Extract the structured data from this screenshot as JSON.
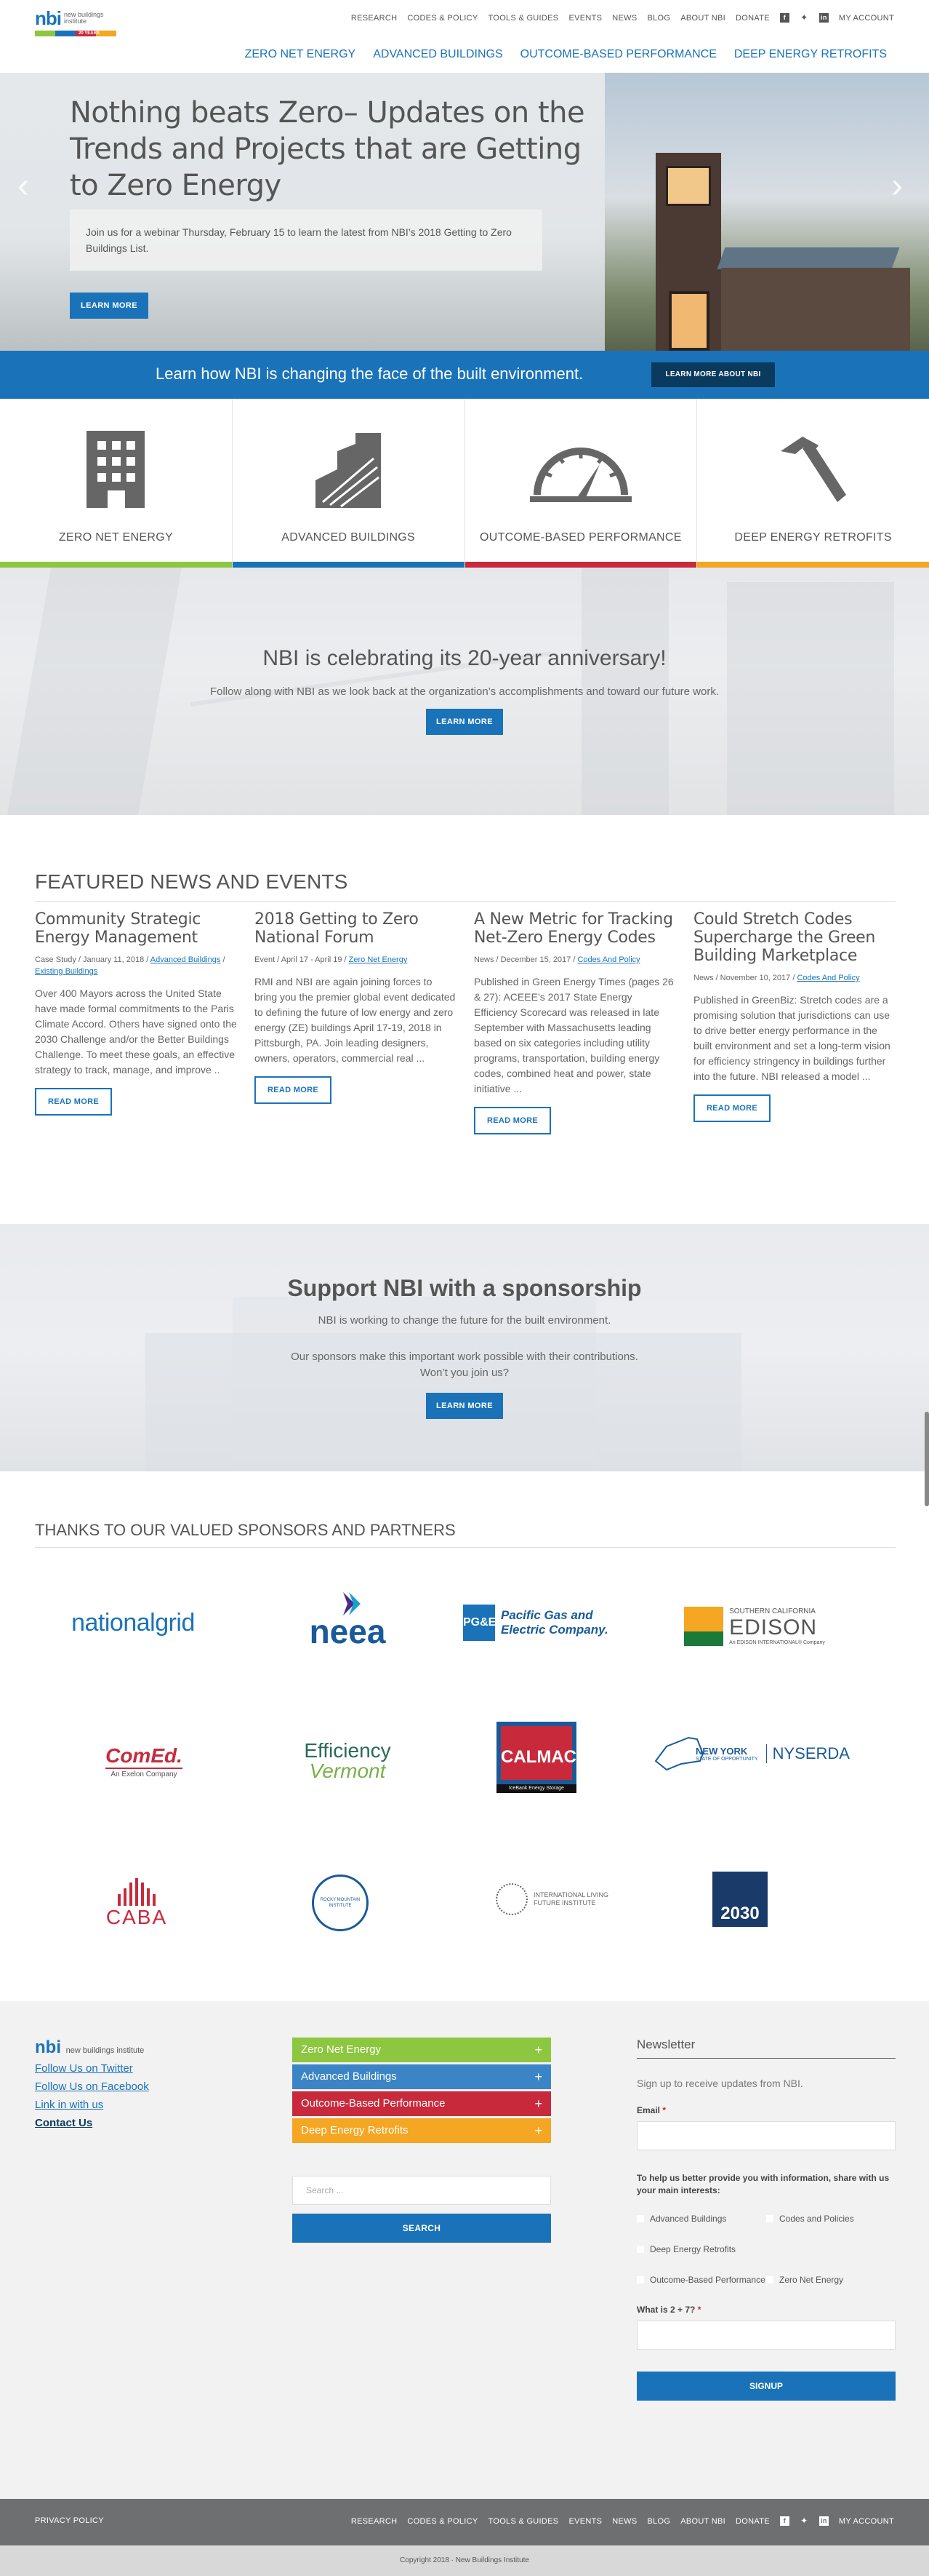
{
  "header": {
    "logo_text": "nbi",
    "logo_subtitle_1": "new buildings",
    "logo_subtitle_2": "institute",
    "logo_years": "20 YEARS",
    "top_nav": [
      "RESEARCH",
      "CODES & POLICY",
      "TOOLS & GUIDES",
      "EVENTS",
      "NEWS",
      "BLOG",
      "ABOUT NBI",
      "DONATE"
    ],
    "social_icons": [
      "facebook-icon",
      "twitter-icon",
      "linkedin-icon"
    ],
    "my_account": "MY ACCOUNT",
    "main_nav": [
      "ZERO NET ENERGY",
      "ADVANCED BUILDINGS",
      "OUTCOME-BASED PERFORMANCE",
      "DEEP ENERGY RETROFITS"
    ]
  },
  "hero": {
    "title": "Nothing beats Zero– Updates on the Trends and Projects that are Getting to Zero Energy",
    "body": "Join us for a webinar Thursday, February 15 to learn the latest from NBI’s 2018 Getting to Zero Buildings List.",
    "button": "LEARN MORE",
    "prev_icon": "‹",
    "next_icon": "›"
  },
  "band": {
    "text": "Learn how NBI is changing the face of the built environment.",
    "button": "LEARN MORE ABOUT NBI"
  },
  "categories": [
    {
      "label": "ZERO NET ENERGY",
      "icon": "building-icon",
      "color": "#8dc63f"
    },
    {
      "label": "ADVANCED BUILDINGS",
      "icon": "skyline-icon",
      "color": "#1a73b9"
    },
    {
      "label": "OUTCOME-BASED PERFORMANCE",
      "icon": "gauge-icon",
      "color": "#c82a3c"
    },
    {
      "label": "DEEP ENERGY RETROFITS",
      "icon": "hammer-icon",
      "color": "#f5a623"
    }
  ],
  "anniversary": {
    "title": "NBI is celebrating its 20-year anniversary!",
    "body": "Follow along with NBI as we look back at the organization’s accomplishments and toward our future work.",
    "button": "LEARN MORE"
  },
  "featured": {
    "heading": "FEATURED NEWS AND EVENTS",
    "posts": [
      {
        "title": "Community Strategic Energy Management",
        "meta_prefix": "Case Study / January 11, 2018 /",
        "tags": [
          "Advanced Buildings",
          "Existing Buildings"
        ],
        "tag_sep": " / ",
        "body": "Over 400 Mayors across the United State have made formal commitments to the Paris Climate Accord. Others have signed onto the 2030 Challenge and/or the Better Buildings Challenge. To meet these goals, an effective strategy to track, manage, and improve ..",
        "button": "READ MORE"
      },
      {
        "title": "2018 Getting to Zero National Forum",
        "meta_prefix": "Event / April 17 - April 19 /",
        "tags": [
          "Zero Net Energy"
        ],
        "tag_sep": "",
        "body": "RMI and NBI are again joining forces to bring you the premier global event dedicated to defining the future of low energy and zero energy (ZE) buildings April 17-19, 2018 in Pittsburgh, PA. Join leading designers, owners, operators, commercial real ...",
        "button": "READ MORE"
      },
      {
        "title": "A New Metric for Tracking Net-Zero Energy Codes",
        "meta_prefix": "News / December 15, 2017 /",
        "tags": [
          "Codes And Policy"
        ],
        "tag_sep": "",
        "body": "Published in Green Energy Times (pages 26 & 27): ACEEE’s 2017 State Energy Efficiency Scorecard was released in late September with Massachusetts leading based on six categories including utility programs, transportation, building energy codes, combined heat and power, state initiative ...",
        "button": "READ MORE"
      },
      {
        "title": "Could Stretch Codes Supercharge the Green Building Marketplace",
        "meta_prefix": "News / November 10, 2017 /",
        "tags": [
          "Codes And Policy"
        ],
        "tag_sep": "",
        "body": "Published in GreenBiz: Stretch codes are a promising solution that jurisdictions can use to drive better energy performance in the built environment and set a long-term vision for efficiency stringency in buildings further into the future. NBI released a model ...",
        "button": "READ MORE"
      }
    ]
  },
  "sponsorship": {
    "title": "Support NBI with a sponsorship",
    "line1": "NBI is working to change the future for the built environment.",
    "line2": "Our sponsors make this important work possible with their contributions.",
    "line3": "Won’t you join us?",
    "button": "LEARN MORE"
  },
  "partners": {
    "heading": "THANKS TO OUR VALUED SPONSORS AND PARTNERS",
    "logos": [
      {
        "name": "national-grid-logo",
        "text": "nationalgrid"
      },
      {
        "name": "neea-logo",
        "text": "neea"
      },
      {
        "name": "pge-logo",
        "text": "Pacific Gas and Electric Company."
      },
      {
        "name": "sce-logo",
        "text": "SOUTHERN CALIFORNIA",
        "text2": "EDISON",
        "text3": "An EDISON INTERNATIONAL® Company"
      },
      {
        "name": "comed-logo",
        "text": "ComEd.",
        "text2": "An Exelon Company"
      },
      {
        "name": "efficiency-vermont-logo",
        "text": "Efficiency",
        "text2": "Vermont"
      },
      {
        "name": "calmac-logo",
        "text": "CALMAC",
        "text2": "IceBank Energy Storage"
      },
      {
        "name": "nyserda-logo",
        "text": "NEW YORK",
        "text2": "STATE OF OPPORTUNITY.",
        "text3": "NYSERDA"
      },
      {
        "name": "caba-logo",
        "text": "CABA"
      },
      {
        "name": "rmi-logo",
        "text": "ROCKY MOUNTAIN INSTITUTE"
      },
      {
        "name": "ilfi-logo",
        "text": "INTERNATIONAL LIVING FUTURE INSTITUTE"
      },
      {
        "name": "architecture-2030-logo",
        "text": "2030"
      }
    ]
  },
  "footer": {
    "logo_text": "nbi",
    "logo_sub": "new buildings institute",
    "links": [
      "Follow Us on Twitter",
      "Follow Us on Facebook",
      "Link in with us"
    ],
    "contact": "Contact Us",
    "accordion": [
      {
        "label": "Zero Net Energy",
        "color": "#8dc63f"
      },
      {
        "label": "Advanced Buildings",
        "color": "#3b85c6"
      },
      {
        "label": "Outcome-Based Performance",
        "color": "#c82a3c"
      },
      {
        "label": "Deep Energy Retrofits",
        "color": "#f5a623"
      }
    ],
    "plus": "+",
    "search_placeholder": "Search ...",
    "search_button": "SEARCH",
    "newsletter": {
      "title": "Newsletter",
      "subtitle": "Sign up to receive updates from NBI.",
      "email_label": "Email",
      "required": "*",
      "interests_label": "To help us better provide you with information, share with us your main interests:",
      "interests": [
        "Advanced Buildings",
        "Codes and Policies",
        "Deep Energy Retrofits",
        "",
        "Outcome-Based Performance",
        "Zero Net Energy"
      ],
      "captcha_label": "What is 2 + 7?",
      "button": "SIGNUP"
    }
  },
  "bottom_bar": {
    "privacy": "PRIVACY POLICY",
    "nav": [
      "RESEARCH",
      "CODES & POLICY",
      "TOOLS & GUIDES",
      "EVENTS",
      "NEWS",
      "BLOG",
      "ABOUT NBI",
      "DONATE"
    ],
    "my_account": "MY ACCOUNT",
    "copyright": "Copyright 2018 · New Buildings Institute"
  }
}
